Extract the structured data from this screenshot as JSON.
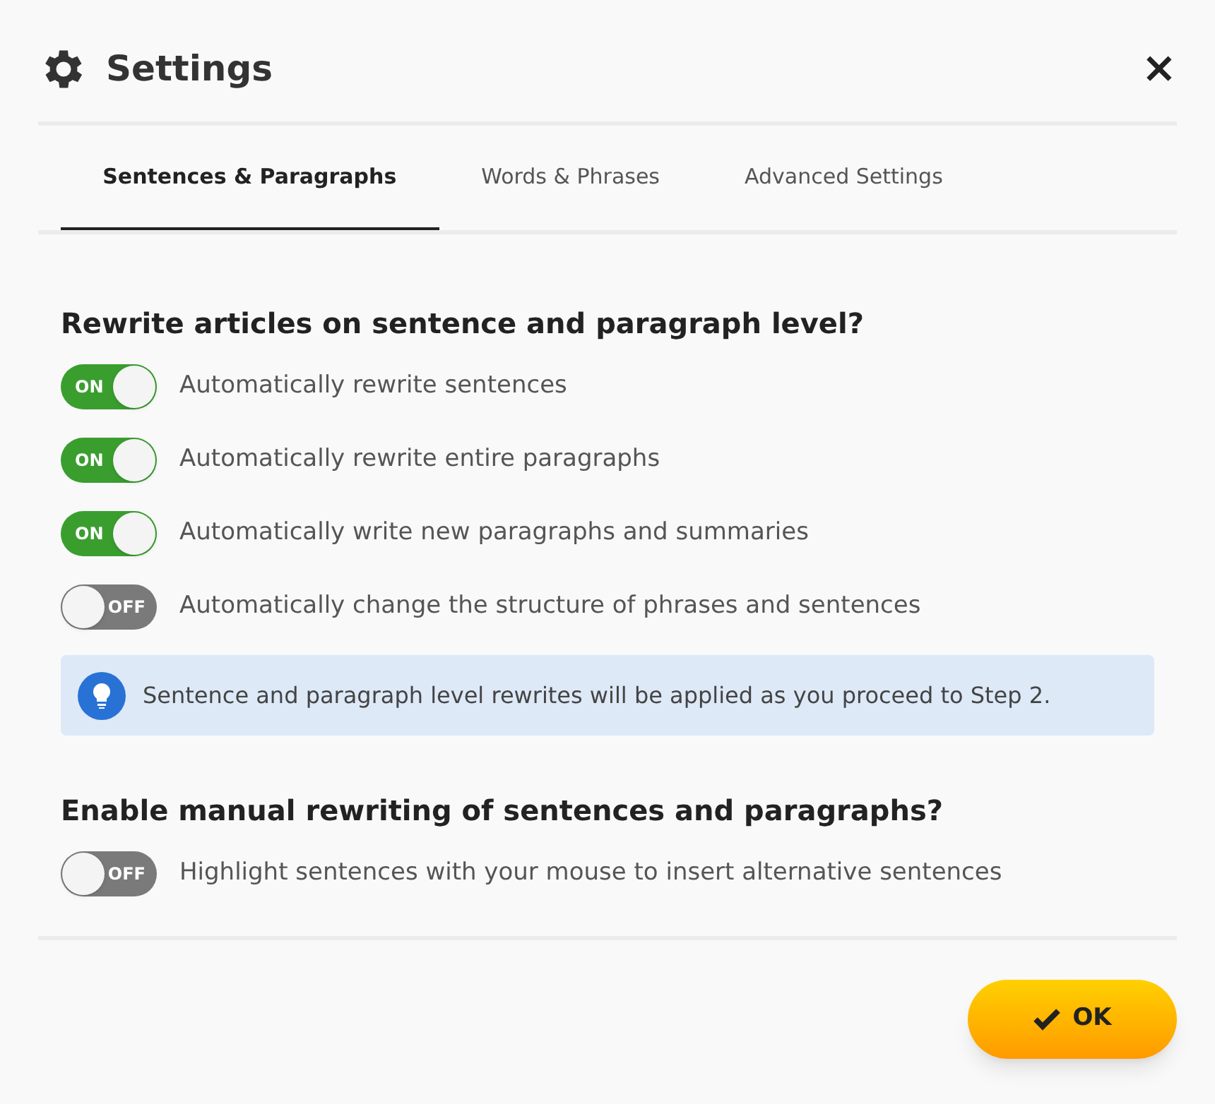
{
  "window": {
    "title": "Settings",
    "close": "×"
  },
  "tabs": [
    {
      "label": "Sentences & Paragraphs",
      "selected": true
    },
    {
      "label": "Words & Phrases",
      "selected": false
    },
    {
      "label": "Advanced Settings",
      "selected": false
    }
  ],
  "sections": [
    {
      "heading": "Rewrite articles on sentence and paragraph level?",
      "toggles": [
        {
          "label": "Automatically rewrite sentences",
          "on": true,
          "state_text": "ON"
        },
        {
          "label": "Automatically rewrite entire paragraphs",
          "on": true,
          "state_text": "ON"
        },
        {
          "label": "Automatically write new paragraphs and summaries",
          "on": true,
          "state_text": "ON"
        },
        {
          "label": "Automatically change the structure of phrases and sentences",
          "on": false,
          "state_text": "OFF"
        }
      ],
      "note": "Sentence and paragraph level rewrites will be applied as you proceed to Step 2."
    },
    {
      "heading": "Enable manual rewriting of sentences and paragraphs?",
      "toggles": [
        {
          "label": "Highlight sentences with your mouse to insert alternative sentences",
          "on": false,
          "state_text": "OFF"
        }
      ]
    }
  ],
  "ok_button": "OK"
}
